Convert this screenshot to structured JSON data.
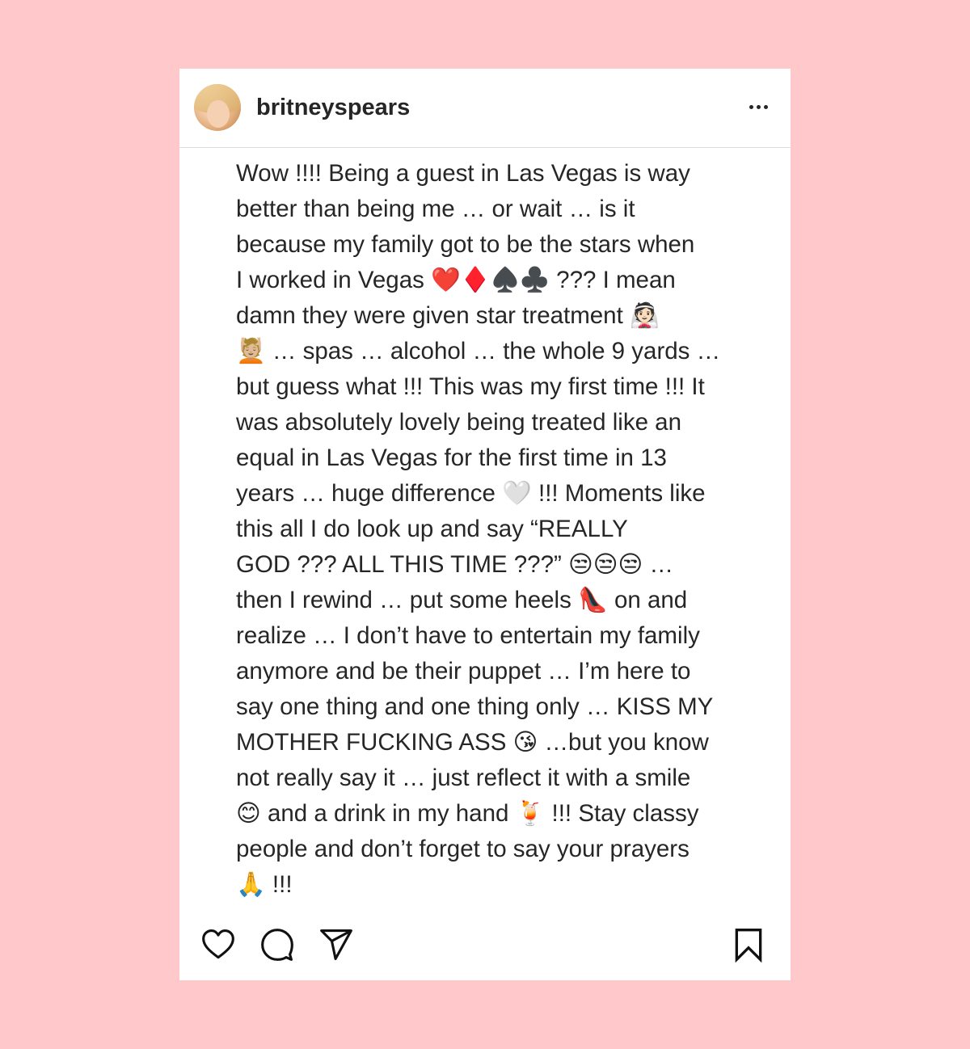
{
  "post": {
    "username": "britneyspears",
    "caption_lines": [
      "Wow !!!! Being a guest in Las Vegas is way",
      "better than being me … or wait … is it",
      "because my family got to be the stars when",
      "I worked in Vegas ❤️♦️♠️♣️ ??? I mean",
      "damn they were given star treatment 👰🏻",
      "💆🏼 … spas … alcohol … the whole 9 yards …",
      "but guess what !!! This was my first time !!! It",
      "was absolutely lovely being treated like an",
      "equal in Las Vegas for the first time in 13",
      "years … huge difference 🤍 !!! Moments like",
      "this all I do look up and say “REALLY",
      "GOD ??? ALL THIS TIME ???” 😒😒😒 …",
      "then I rewind … put some heels 👠 on and",
      "realize … I don’t have to entertain my family",
      "anymore and be their puppet … I’m here to",
      "say one thing and one thing only … KISS MY",
      "MOTHER FUCKING ASS 😘 …but you know",
      "not really say it … just reflect it with a smile",
      "😊 and a drink in my hand 🍹 !!! Stay classy",
      "people and don’t forget to say your prayers",
      "🙏 !!!"
    ]
  },
  "actions": {
    "icons": [
      "heart-icon",
      "comment-icon",
      "share-icon",
      "bookmark-icon"
    ]
  },
  "colors": {
    "background": "#ffc9cb",
    "card": "#ffffff",
    "text": "#262626",
    "divider": "#dedede"
  }
}
